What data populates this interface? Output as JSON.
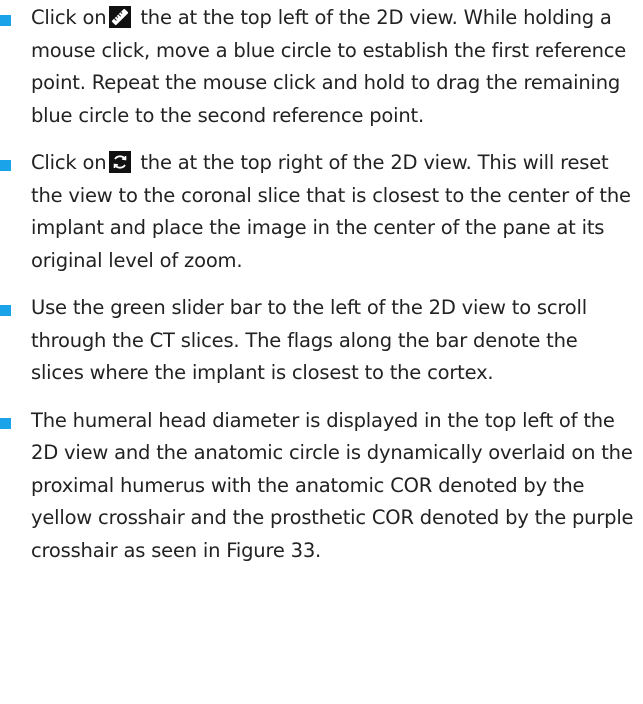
{
  "colors": {
    "bullet": "#1aa3e8",
    "text": "#222222",
    "icon_background": "#111111"
  },
  "instructions": [
    {
      "icon": "ruler-icon",
      "before": "Click on",
      "after": "the at the top left of the 2D view. While holding a mouse click, move a blue circle to establish the first reference point. Repeat the mouse click and hold to drag the remaining blue circle to the second reference point."
    },
    {
      "icon": "reset-view-icon",
      "before": "Click on",
      "after": "the at the top right of the 2D view. This will reset the view to the coronal slice that is closest to the center of the implant and place the image in the center of the pane at its original level of zoom."
    },
    {
      "text": "Use the green slider bar to the left of the 2D view to scroll through the CT slices. The flags along the bar denote the slices where the implant is closest to the cortex."
    },
    {
      "text": "The humeral head diameter is displayed in the top left of the 2D view and the anatomic circle is dynamically overlaid on the proximal humerus with the anatomic COR denoted by the yellow crosshair and the prosthetic COR denoted by the purple crosshair as seen in Figure 33."
    }
  ]
}
